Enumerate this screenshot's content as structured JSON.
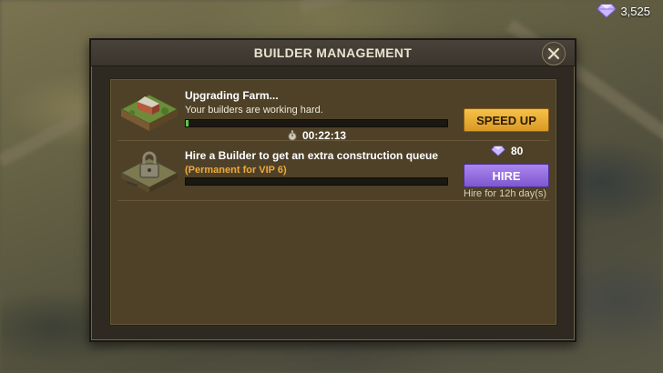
{
  "currency": {
    "icon": "gem-icon",
    "amount": "3,525"
  },
  "dialog": {
    "title": "BUILDER MANAGEMENT",
    "close_icon": "close-icon"
  },
  "queues": [
    {
      "icon": "farm-building-icon",
      "title": "Upgrading Farm...",
      "subtitle": "Your builders are working hard.",
      "progress": 0.01,
      "timer_icon": "stopwatch-icon",
      "timer": "00:22:13",
      "button_label": "SPEED UP"
    },
    {
      "icon": "locked-plot-icon",
      "title": "Hire a Builder to get an extra construction queue",
      "subtitle": "(Permanent for VIP 6)",
      "progress": 0,
      "cost": "80",
      "button_label": "HIRE",
      "note": "Hire for 12h day(s)"
    }
  ],
  "colors": {
    "speed_up_button": "#e8ad35",
    "hire_button": "#9570e0",
    "vip_text": "#f0a93a",
    "progress_fill": "#59c84b"
  }
}
